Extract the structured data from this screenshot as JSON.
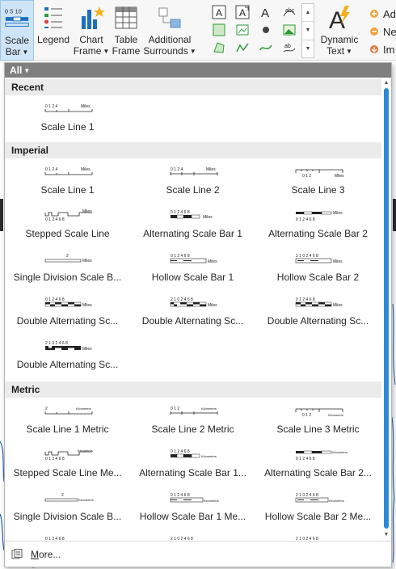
{
  "ribbon": {
    "buttons": [
      {
        "line1": "Scale",
        "line2": "Bar",
        "dropdown": true,
        "active": true
      },
      {
        "line1": "Legend",
        "line2": "",
        "dropdown": false,
        "active": false
      },
      {
        "line1": "Chart",
        "line2": "Frame",
        "dropdown": true,
        "active": false
      },
      {
        "line1": "Table",
        "line2": "Frame",
        "dropdown": false,
        "active": false
      },
      {
        "line1": "Additional",
        "line2": "Surrounds",
        "dropdown": true,
        "active": false
      },
      {
        "line1": "Dynamic",
        "line2": "Text",
        "dropdown": true,
        "active": false
      }
    ],
    "scale_icon_text": "0 5 10",
    "right_items": [
      "Ad",
      "Ne",
      "Im"
    ]
  },
  "panel": {
    "filter_label": "All",
    "sections": [
      {
        "title": "Recent",
        "items": [
          "Scale Line 1"
        ]
      },
      {
        "title": "Imperial",
        "items": [
          "Scale Line 1",
          "Scale Line 2",
          "Scale Line 3",
          "Stepped Scale Line",
          "Alternating Scale Bar 1",
          "Alternating Scale Bar 2",
          "Single Division Scale B...",
          "Hollow Scale Bar 1",
          "Hollow Scale Bar 2",
          "Double Alternating Sc...",
          "Double Alternating Sc...",
          "Double Alternating Sc...",
          "Double Alternating Sc..."
        ]
      },
      {
        "title": "Metric",
        "items": [
          "Scale Line 1 Metric",
          "Scale Line 2 Metric",
          "Scale Line 3 Metric",
          "Stepped Scale Line Me...",
          "Alternating Scale Bar 1...",
          "Alternating Scale Bar 2...",
          "Single Division Scale B...",
          "Hollow Scale Bar 1 Me...",
          "Hollow Scale Bar 2 Me...",
          "",
          "",
          ""
        ]
      }
    ],
    "previews": {
      "miles": "Miles",
      "kilometers": "Kilometers",
      "ticks_a": "0   1   2       4",
      "ticks_b": "0 1 2   4   6   8",
      "ticks_c": "2 1 0   2   4   6   8",
      "ticks_d": "2",
      "ticks_e": "0   1   2"
    },
    "more_label": "More..."
  },
  "colors": {
    "accent": "#2e8ad8",
    "active_button": "#cfe4f7",
    "filter_bar": "#7f7f7f",
    "section_bg": "#ebebeb",
    "map_line": "#1f5fb5"
  }
}
